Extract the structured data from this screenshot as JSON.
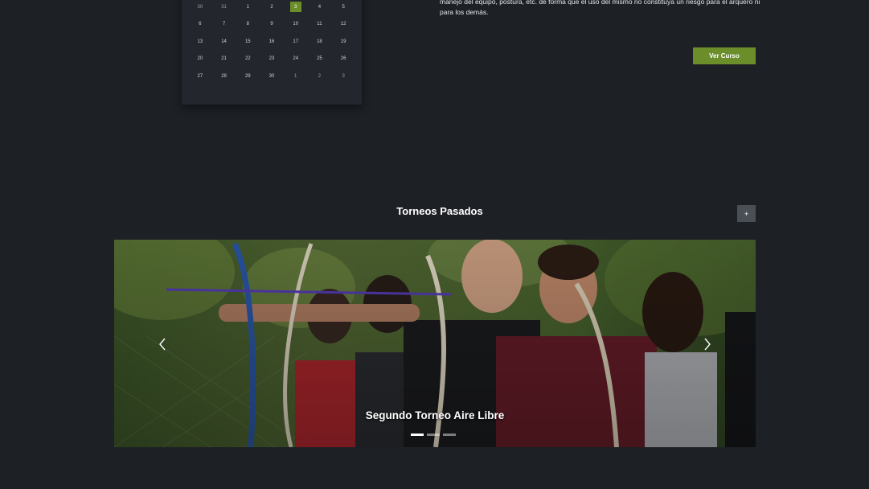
{
  "calendar": {
    "weeks": [
      [
        "30",
        "31",
        "1",
        "2",
        "3",
        "4",
        "5"
      ],
      [
        "6",
        "7",
        "8",
        "9",
        "10",
        "11",
        "12"
      ],
      [
        "13",
        "14",
        "15",
        "16",
        "17",
        "18",
        "19"
      ],
      [
        "20",
        "21",
        "22",
        "23",
        "24",
        "25",
        "26"
      ],
      [
        "27",
        "28",
        "29",
        "30",
        "1",
        "2",
        "3"
      ]
    ],
    "active_day": "3",
    "accent_color": "#6b8e2b"
  },
  "course": {
    "description": "manejo del equipo, postura, etc. de forma que el uso del mismo no constituya un riesgo para el arquero ni para los demás.",
    "button_label": "Ver Curso"
  },
  "past_tournaments": {
    "title": "Torneos Pasados",
    "more_label": "+",
    "carousel": {
      "slides": [
        {
          "caption": "Segundo Torneo Aire Libre"
        }
      ],
      "indicator_count": 3,
      "active_index": 0,
      "prev_icon": "chevron-left-icon",
      "next_icon": "chevron-right-icon"
    }
  }
}
